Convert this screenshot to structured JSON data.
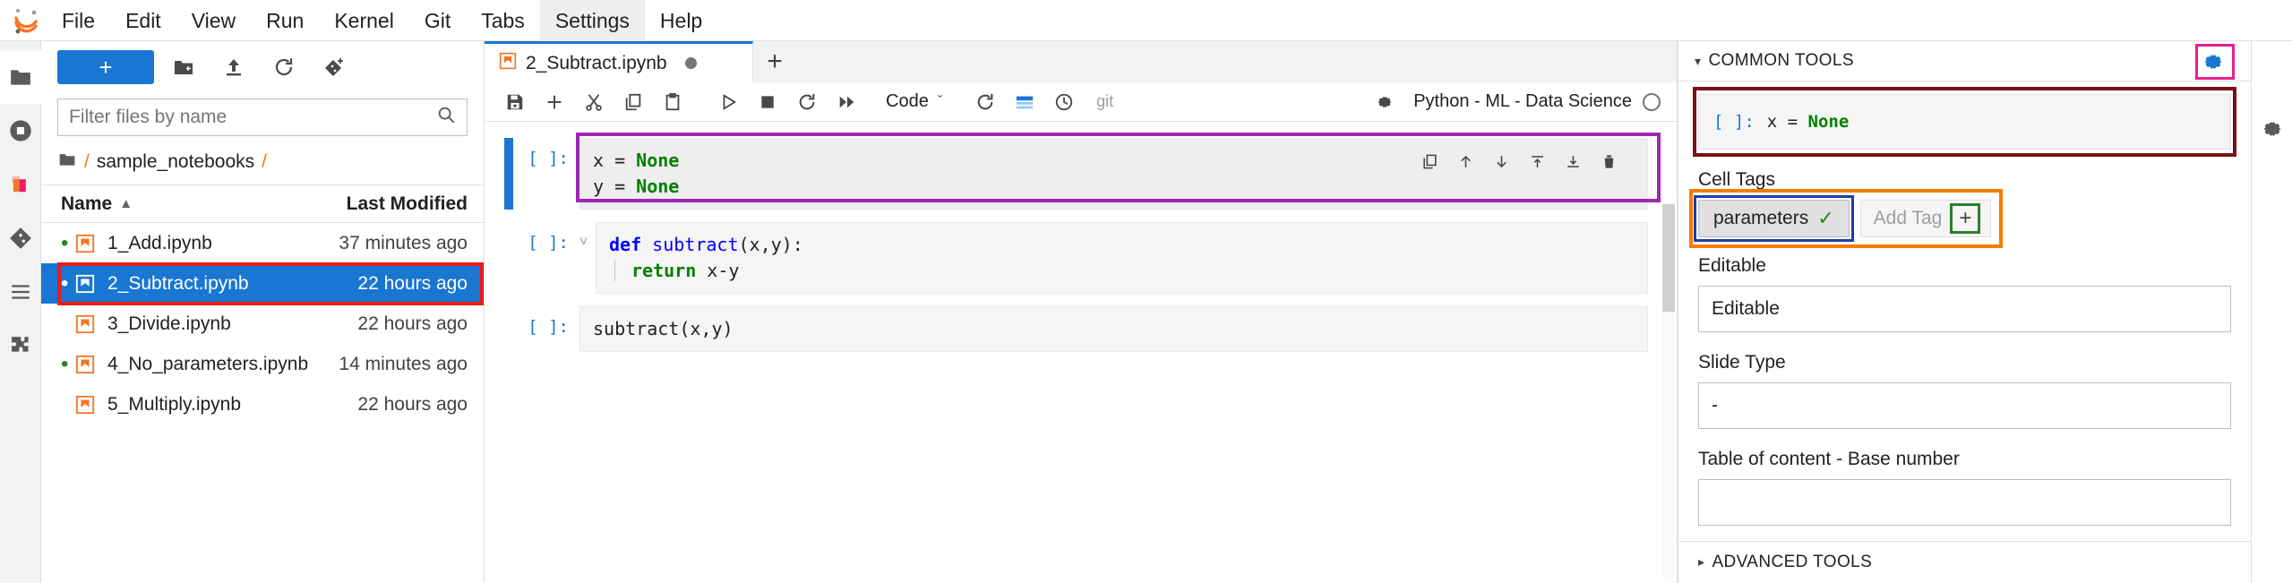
{
  "menubar": {
    "logo": "jupyter-logo",
    "items": [
      {
        "label": "File",
        "active": false
      },
      {
        "label": "Edit",
        "active": false
      },
      {
        "label": "View",
        "active": false
      },
      {
        "label": "Run",
        "active": false
      },
      {
        "label": "Kernel",
        "active": false
      },
      {
        "label": "Git",
        "active": false
      },
      {
        "label": "Tabs",
        "active": false
      },
      {
        "label": "Settings",
        "active": true
      },
      {
        "label": "Help",
        "active": false
      }
    ]
  },
  "activitybar": {
    "items": [
      {
        "name": "folder-icon",
        "selected": true
      },
      {
        "name": "running-terminals-icon",
        "selected": false
      },
      {
        "name": "commands-palette-icon",
        "selected": false
      },
      {
        "name": "git-icon",
        "selected": false
      },
      {
        "name": "table-of-contents-icon",
        "selected": false
      },
      {
        "name": "extension-manager-icon",
        "selected": false
      }
    ]
  },
  "filebrowser": {
    "new_launcher_label": "+",
    "toolbar_icons": [
      "new-folder-icon",
      "upload-icon",
      "refresh-icon",
      "git-clone-icon"
    ],
    "filter_placeholder": "Filter files by name",
    "filter_value": "",
    "breadcrumb": {
      "home_icon": "folder-icon",
      "lead_sep": "/",
      "path": "sample_notebooks",
      "trail_sep": "/"
    },
    "columns": {
      "name": "Name",
      "last_modified": "Last Modified"
    },
    "sort_caret": "▲",
    "files": [
      {
        "name": "1_Add.ipynb",
        "modified": "37 minutes ago",
        "running": true,
        "selected": false
      },
      {
        "name": "2_Subtract.ipynb",
        "modified": "22 hours ago",
        "running": true,
        "selected": true
      },
      {
        "name": "3_Divide.ipynb",
        "modified": "22 hours ago",
        "running": false,
        "selected": false
      },
      {
        "name": "4_No_parameters.ipynb",
        "modified": "14 minutes ago",
        "running": true,
        "selected": false
      },
      {
        "name": "5_Multiply.ipynb",
        "modified": "22 hours ago",
        "running": false,
        "selected": false
      }
    ]
  },
  "notebook": {
    "tab": {
      "title": "2_Subtract.ipynb",
      "icon": "notebook-icon",
      "dirty": true
    },
    "add_tab_label": "+",
    "toolbar": {
      "icons": [
        "save-icon",
        "insert-cell-icon",
        "cut-icon",
        "copy-icon",
        "paste-icon",
        "run-icon",
        "stop-icon",
        "restart-icon",
        "restart-run-all-icon"
      ],
      "celltype": "Code",
      "celltype_caret": "ˇ",
      "extra_icons": [
        "refresh-kernel-icon",
        "cell-toolbar-icon",
        "history-icon"
      ],
      "git_label": "git",
      "settings_gear": "gear-icon",
      "kernel_name": "Python - ML - Data Science",
      "kernel_status": "idle"
    },
    "cells": [
      {
        "prompt": "[ ]:",
        "active": true,
        "lines": [
          {
            "segments": [
              {
                "t": "x = ",
                "c": "plain"
              },
              {
                "t": "None",
                "c": "kw"
              }
            ]
          },
          {
            "segments": [
              {
                "t": "y = ",
                "c": "plain"
              },
              {
                "t": "None",
                "c": "kw"
              }
            ]
          }
        ],
        "actions": [
          "duplicate-icon",
          "move-up-icon",
          "move-down-icon",
          "insert-above-icon",
          "insert-below-icon",
          "delete-icon"
        ]
      },
      {
        "prompt": "[ ]:",
        "active": false,
        "lines": [
          {
            "segments": [
              {
                "t": "def ",
                "c": "def"
              },
              {
                "t": "subtract",
                "c": "fn"
              },
              {
                "t": "(x,y):",
                "c": "plain"
              }
            ]
          },
          {
            "segments": [
              {
                "t": "    ",
                "c": "plain"
              },
              {
                "t": "return",
                "c": "kw"
              },
              {
                "t": " x-y",
                "c": "plain"
              }
            ]
          }
        ],
        "actions": []
      },
      {
        "prompt": "[ ]:",
        "active": false,
        "lines": [
          {
            "segments": [
              {
                "t": "subtract(x,y)",
                "c": "plain"
              }
            ]
          }
        ],
        "actions": []
      }
    ]
  },
  "rightpanel": {
    "header_title": "COMMON TOOLS",
    "header_caret": "▾",
    "header_gear": "gear-icon",
    "side_gear": "gear-icon",
    "cell_preview": {
      "prompt": "[ ]:",
      "code_prefix": "x = ",
      "code_value": "None"
    },
    "cell_tags_label": "Cell Tags",
    "tags": [
      {
        "label": "parameters",
        "check": "✓"
      }
    ],
    "add_tag": {
      "label": "Add Tag",
      "plus": "+"
    },
    "fields": [
      {
        "label": "Editable",
        "value": "Editable"
      },
      {
        "label": "Slide Type",
        "value": "-"
      },
      {
        "label": "Table of content - Base number",
        "value": ""
      }
    ],
    "footer_title": "ADVANCED TOOLS",
    "footer_caret": "▸"
  },
  "annotations": {
    "red": "#e81b1b",
    "purple": "#9c27b0",
    "darkred": "#7b1113",
    "orange": "#f57c00",
    "green": "#2e7d32",
    "pink": "#e91e8c"
  }
}
